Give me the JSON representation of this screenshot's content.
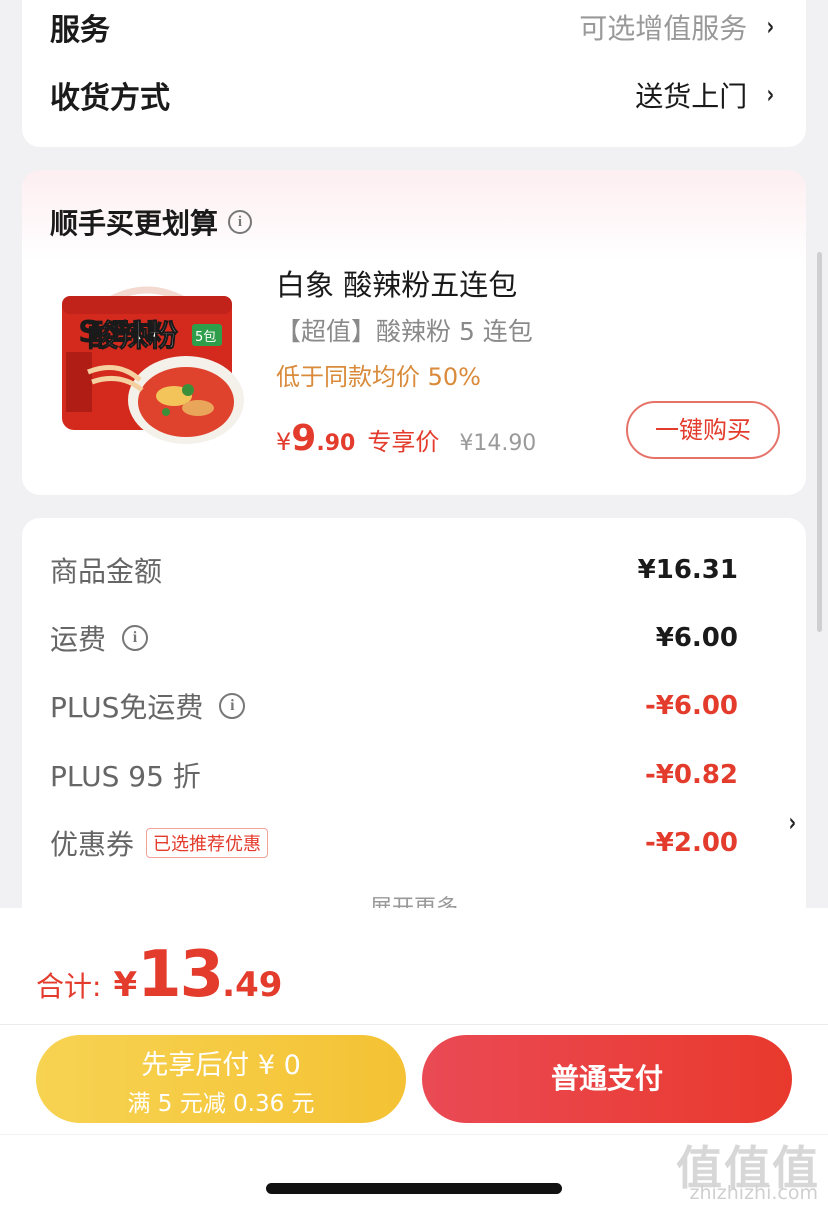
{
  "service_card": {
    "service_label": "服务",
    "service_value": "可选增值服务",
    "delivery_label": "收货方式",
    "delivery_value": "送货上门",
    "chevron": "›"
  },
  "addon": {
    "title": "顺手买更划算",
    "info_icon": "i",
    "product": {
      "name": "白象 酸辣粉五连包",
      "subtitle": "【超值】酸辣粉 5 连包",
      "promo": "低于同款均价 50%",
      "price_currency": "¥",
      "price_int": "9",
      "price_dec": ".90",
      "price_tag": "专享价",
      "original_price": "¥14.90",
      "image_text": "酸辣粉",
      "image_text_en": "S  EN",
      "image_badge": "5包"
    },
    "buy_button": "一键购买"
  },
  "breakdown": {
    "rows": [
      {
        "label": "商品金额",
        "amount": "¥16.31"
      },
      {
        "label": "运费",
        "amount": "¥6.00"
      },
      {
        "label": "PLUS免运费",
        "amount": "-¥6.00"
      },
      {
        "label": "PLUS 95 折",
        "amount": "-¥0.82"
      },
      {
        "label": "优惠券",
        "amount": "-¥2.00",
        "chip": "已选推荐优惠"
      }
    ],
    "expand_more": "展开更多",
    "chevron": "›"
  },
  "bottom": {
    "total_label": "合计:",
    "total_currency": "¥",
    "total_int": "13",
    "total_dec": ".49",
    "pay_later_line1": "先享后付 ¥ 0",
    "pay_later_line2": "满 5 元减 0.36 元",
    "pay_normal": "普通支付"
  },
  "watermark": {
    "glyphs": "值值值",
    "url": "zhizhizhi.com"
  },
  "colors": {
    "accent_red": "#e33b2c",
    "promo_orange": "#d98a3a",
    "pay_later_yellow": "#f4c234",
    "muted_gray": "#999999"
  }
}
